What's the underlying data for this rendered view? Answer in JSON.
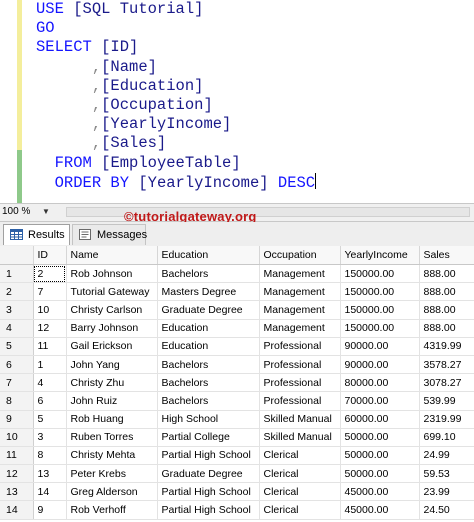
{
  "query": {
    "use_keyword": "USE",
    "use_target": "[SQL Tutorial]",
    "go": "GO",
    "select_keyword": "SELECT",
    "select_first": "[ID]",
    "comma": ",",
    "columns": [
      "[Name]",
      "[Education]",
      "[Occupation]",
      "[YearlyIncome]",
      "[Sales]"
    ],
    "from_keyword": "FROM",
    "from_table": "[EmployeeTable]",
    "order_keyword": "ORDER BY",
    "order_column": "[YearlyIncome]",
    "desc_keyword": "DESC"
  },
  "toolbar": {
    "zoom": "100 %"
  },
  "watermark": "©tutorialgateway.org",
  "tabs": {
    "results": "Results",
    "messages": "Messages"
  },
  "grid": {
    "headers": [
      "ID",
      "Name",
      "Education",
      "Occupation",
      "YearlyIncome",
      "Sales"
    ],
    "rows": [
      {
        "n": "1",
        "cells": [
          "2",
          "Rob Johnson",
          "Bachelors",
          "Management",
          "150000.00",
          "888.00"
        ]
      },
      {
        "n": "2",
        "cells": [
          "7",
          "Tutorial Gateway",
          "Masters Degree",
          "Management",
          "150000.00",
          "888.00"
        ]
      },
      {
        "n": "3",
        "cells": [
          "10",
          "Christy Carlson",
          "Graduate Degree",
          "Management",
          "150000.00",
          "888.00"
        ]
      },
      {
        "n": "4",
        "cells": [
          "12",
          "Barry Johnson",
          "Education",
          "Management",
          "150000.00",
          "888.00"
        ]
      },
      {
        "n": "5",
        "cells": [
          "11",
          "Gail Erickson",
          "Education",
          "Professional",
          "90000.00",
          "4319.99"
        ]
      },
      {
        "n": "6",
        "cells": [
          "1",
          "John Yang",
          "Bachelors",
          "Professional",
          "90000.00",
          "3578.27"
        ]
      },
      {
        "n": "7",
        "cells": [
          "4",
          "Christy Zhu",
          "Bachelors",
          "Professional",
          "80000.00",
          "3078.27"
        ]
      },
      {
        "n": "8",
        "cells": [
          "6",
          "John Ruiz",
          "Bachelors",
          "Professional",
          "70000.00",
          "539.99"
        ]
      },
      {
        "n": "9",
        "cells": [
          "5",
          "Rob Huang",
          "High School",
          "Skilled Manual",
          "60000.00",
          "2319.99"
        ]
      },
      {
        "n": "10",
        "cells": [
          "3",
          "Ruben Torres",
          "Partial College",
          "Skilled Manual",
          "50000.00",
          "699.10"
        ]
      },
      {
        "n": "11",
        "cells": [
          "8",
          "Christy Mehta",
          "Partial High School",
          "Clerical",
          "50000.00",
          "24.99"
        ]
      },
      {
        "n": "12",
        "cells": [
          "13",
          "Peter Krebs",
          "Graduate Degree",
          "Clerical",
          "50000.00",
          "59.53"
        ]
      },
      {
        "n": "13",
        "cells": [
          "14",
          "Greg Alderson",
          "Partial High School",
          "Clerical",
          "45000.00",
          "23.99"
        ]
      },
      {
        "n": "14",
        "cells": [
          "9",
          "Rob Verhoff",
          "Partial High School",
          "Clerical",
          "45000.00",
          "24.50"
        ]
      }
    ]
  }
}
